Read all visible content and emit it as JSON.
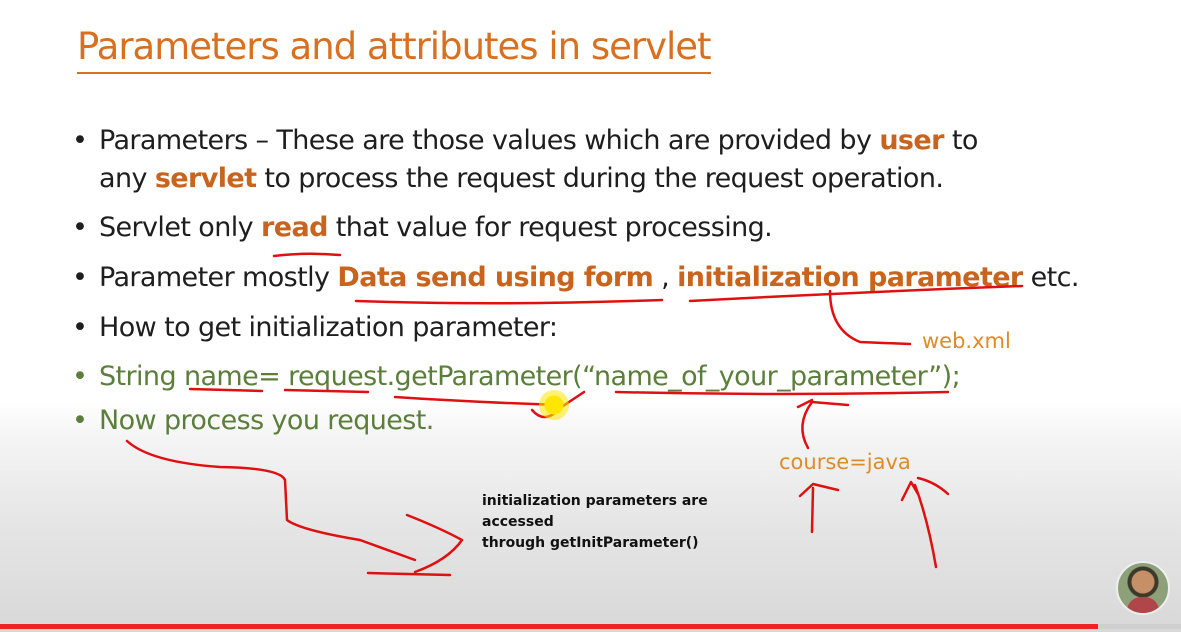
{
  "slide": {
    "title": "Parameters and attributes in servlet",
    "bullets": [
      {
        "line1_pre": "Parameters – These are those values which are provided by ",
        "line1_hl": "user",
        "line1_post": " to",
        "line2_pre": "any ",
        "line2_hl": "servlet",
        "line2_post": " to process the request during the request operation."
      },
      {
        "pre": "Servlet only ",
        "hl": "read",
        "post": " that value for request processing."
      },
      {
        "pre": "Parameter mostly ",
        "hl1": "Data send using form",
        "mid": " , ",
        "hl2": "initialization parameter",
        "post": " etc."
      },
      {
        "text": "How to get initialization parameter:"
      },
      {
        "text": "String name= request.getParameter(“name_of_your_parameter”);"
      },
      {
        "text": "Now process you request."
      }
    ],
    "bullet_symbol": "•"
  },
  "annotations": {
    "web_xml": "web.xml",
    "course_java": "course=java",
    "caption_line1": "initialization parameters are accessed",
    "caption_line2": "through getInitParameter()"
  },
  "video": {
    "progress_fraction": 0.93,
    "progress_color": "#ee2222"
  },
  "colors": {
    "title": "#d87020",
    "highlight": "#c8641e",
    "green_text": "#5b7f3b",
    "ink": "#e01010"
  }
}
